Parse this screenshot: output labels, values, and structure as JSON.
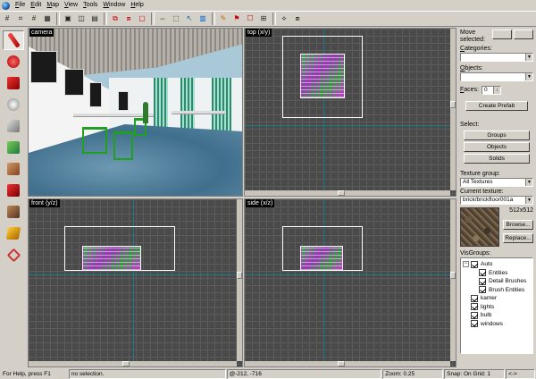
{
  "menu": [
    "File",
    "Edit",
    "Map",
    "View",
    "Tools",
    "Window",
    "Help"
  ],
  "viewports": {
    "camera": "camera",
    "top": "top (x/y)",
    "front": "front (y/z)",
    "side": "side (x/z)"
  },
  "panel": {
    "move_selected": "Move selected:",
    "categories_label": "Categories:",
    "categories_value": "",
    "objects_label": "Objects:",
    "objects_value": "",
    "faces_label": "Faces:",
    "faces_value": "0",
    "create_prefab": "Create Prefab",
    "select_label": "Select:",
    "groups": "Groups",
    "objects_btn": "Objects",
    "solids": "Solids",
    "texture_group_label": "Texture group:",
    "texture_group_value": "All Textures",
    "current_texture_label": "Current texture:",
    "current_texture_value": "brick/brickfloor001a",
    "texture_size": "512x512",
    "browse": "Browse...",
    "replace": "Replace...",
    "visgroups_label": "VisGroups:",
    "visgroups": [
      {
        "label": "Auto",
        "level": 0,
        "tree": "−"
      },
      {
        "label": "Entities",
        "level": 1
      },
      {
        "label": "Detail Brushes",
        "level": 1
      },
      {
        "label": "Brush Entities",
        "level": 1
      },
      {
        "label": "kamer",
        "level": 0
      },
      {
        "label": "lights",
        "level": 0
      },
      {
        "label": "bulb",
        "level": 0
      },
      {
        "label": "windows",
        "level": 0
      }
    ]
  },
  "status": {
    "help": "For Help, press F1",
    "selection": "no selection.",
    "coords": "@-212, -716",
    "zoom": "Zoom: 0.25",
    "snap": "Snap: On Grid: 1",
    "nav": "<->"
  },
  "icons": {
    "toolbar": [
      "grid-icon",
      "grid-small-icon",
      "grid-large-icon",
      "texture-lock-icon",
      "carve-icon",
      "hollow-icon",
      "group-icon",
      "ungroup-icon",
      "hide-icon",
      "unhide-icon",
      "scale-icon",
      "select-box-icon",
      "cursor-icon",
      "texture-icon",
      "entity-icon",
      "run-map-icon",
      "clip-icon",
      "vertex-icon"
    ],
    "palette": [
      "selection-tool-icon",
      "magnify-tool-icon",
      "camera-tool-icon",
      "entity-tool-icon",
      "block-tool-icon",
      "texture-application-icon",
      "apply-current-texture-icon",
      "decal-tool-icon",
      "overlay-tool-icon",
      "clipping-tool-icon",
      "vertex-tool-icon"
    ]
  }
}
